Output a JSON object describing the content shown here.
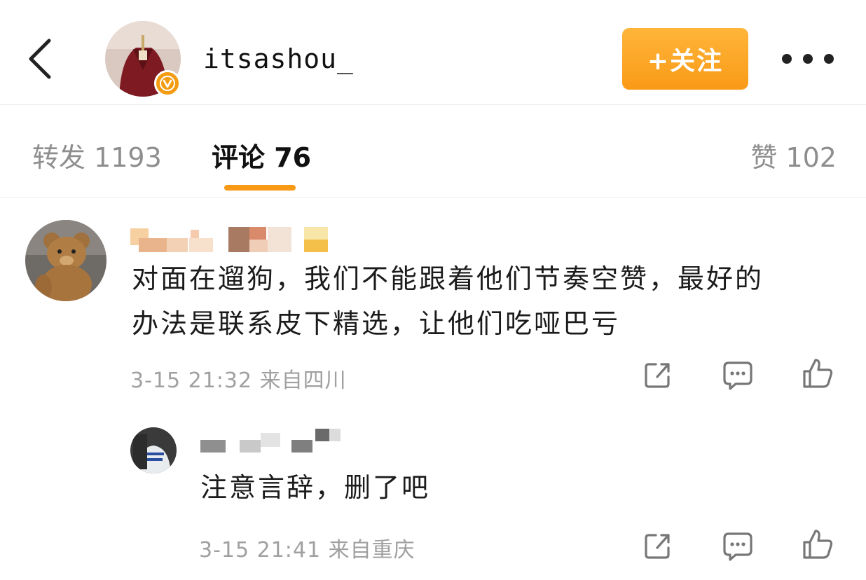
{
  "header": {
    "username": "itsashou_",
    "follow_label": "+关注"
  },
  "tabs": {
    "repost": "转发 1193",
    "comments": "评论 76",
    "likes": "赞 102"
  },
  "comments": [
    {
      "text_line1": "对面在遛狗，我们不能跟着他们节奏空赞，最好的",
      "text_line2": "办法是联系皮下精选，让他们吃哑巴亏",
      "meta": "3-15 21:32 来自四川"
    },
    {
      "text_line1": "注意言辞，删了吧",
      "meta": "3-15 21:41 来自重庆"
    }
  ],
  "icons": {
    "back": "chevron-left-icon",
    "more": "more-dots-icon",
    "verified": "verified-badge-icon",
    "share": "share-icon",
    "comment": "comment-icon",
    "like": "thumbs-up-icon"
  },
  "colors": {
    "accent": "#f99a17",
    "text": "#1b1b1b",
    "muted": "#a0a0a0"
  }
}
